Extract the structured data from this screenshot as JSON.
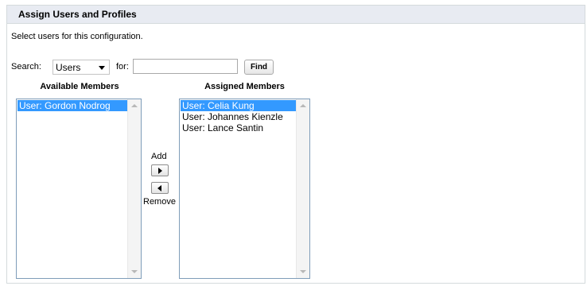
{
  "panel": {
    "title": "Assign Users and Profiles",
    "intro": "Select users for this configuration."
  },
  "search": {
    "label": "Search:",
    "type_selected": "Users",
    "for_label": "for:",
    "query": "",
    "find_label": "Find"
  },
  "available": {
    "header": "Available Members",
    "items": [
      {
        "label": "User: Gordon Nodrog",
        "selected": true
      }
    ]
  },
  "assigned": {
    "header": "Assigned Members",
    "items": [
      {
        "label": "User: Celia Kung",
        "selected": true
      },
      {
        "label": "User: Johannes Kienzle",
        "selected": false
      },
      {
        "label": "User: Lance Santin",
        "selected": false
      }
    ]
  },
  "controls": {
    "add_label": "Add",
    "remove_label": "Remove"
  },
  "colors": {
    "header_bg": "#e8ebf2",
    "selection": "#3399ff"
  }
}
